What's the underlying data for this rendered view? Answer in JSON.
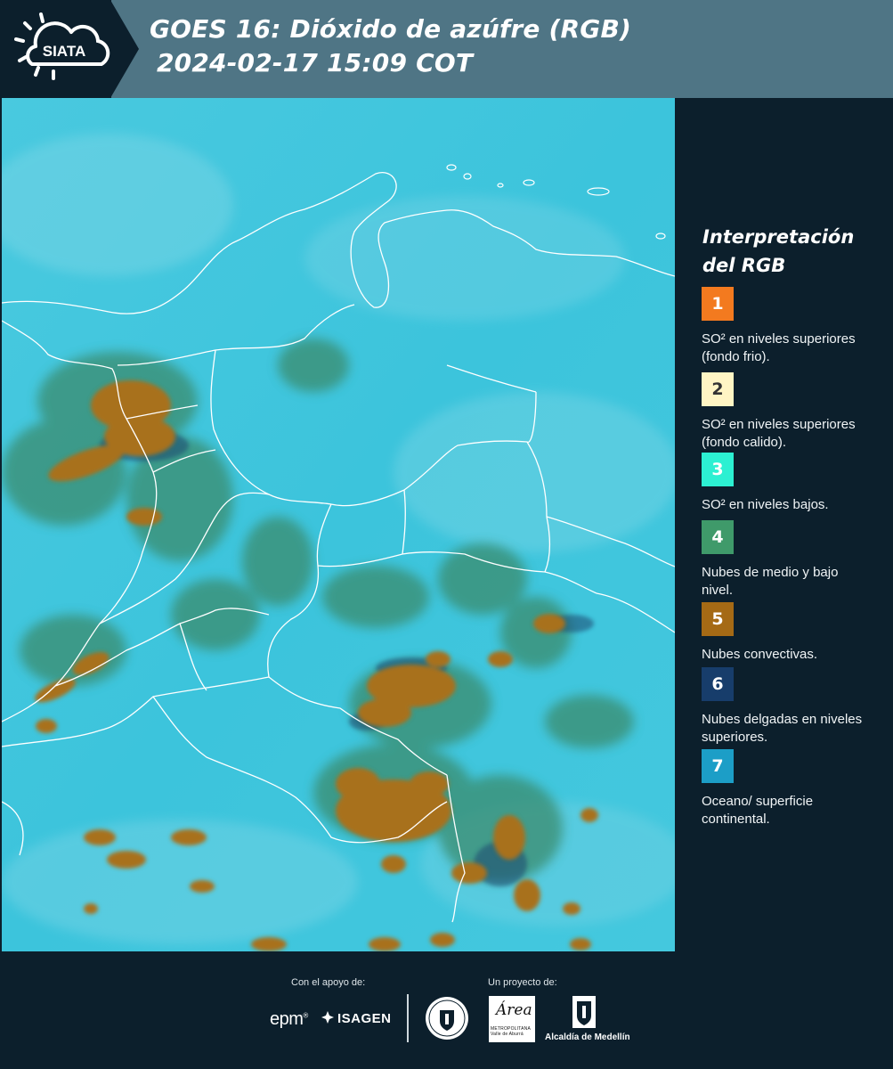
{
  "header": {
    "logo_text": "SIATA",
    "title_line1": "GOES 16: Dióxido de azúfre (RGB)",
    "title_line2": "2024-02-17 15:09 COT"
  },
  "legend": {
    "title_line1": "Interpretación",
    "title_line2": "del RGB",
    "items": [
      {
        "number": "1",
        "color": "#f37a1f",
        "text_color": "#ffffff",
        "description": "SO² en niveles superiores (fondo frio)."
      },
      {
        "number": "2",
        "color": "#fff5c4",
        "text_color": "#333333",
        "description": "SO² en niveles superiores (fondo calido)."
      },
      {
        "number": "3",
        "color": "#2cf0d2",
        "text_color": "#ffffff",
        "description": "SO² en niveles bajos."
      },
      {
        "number": "4",
        "color": "#3f9a6a",
        "text_color": "#ffffff",
        "description": "Nubes de medio y bajo nivel."
      },
      {
        "number": "5",
        "color": "#a56a15",
        "text_color": "#ffffff",
        "description": "Nubes convectivas."
      },
      {
        "number": "6",
        "color": "#173d6b",
        "text_color": "#ffffff",
        "description": "Nubes delgadas en niveles superiores."
      },
      {
        "number": "7",
        "color": "#1c9ec7",
        "text_color": "#ffffff",
        "description": "Oceano/ superficie continental."
      }
    ]
  },
  "footer": {
    "support_label": "Con el apoyo de:",
    "project_label": "Un proyecto de:",
    "epm_text": "epm",
    "isagen_text": "ISAGEN",
    "area_text": "Área",
    "area_subtext": "METROPOLITANA Valle de Aburrá",
    "alcaldia_text": "Alcaldía de Medellín"
  }
}
